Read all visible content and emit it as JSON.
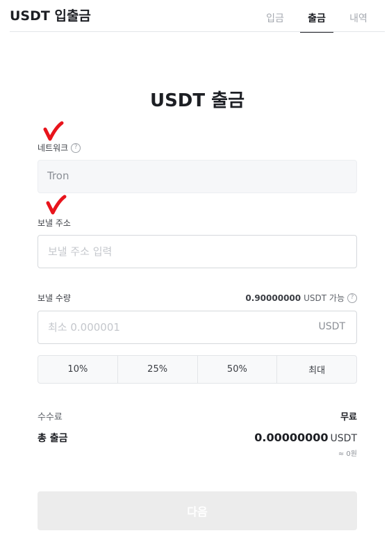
{
  "header": {
    "title": "USDT 입출금",
    "tabs": [
      {
        "label": "입금",
        "active": false
      },
      {
        "label": "출금",
        "active": true
      },
      {
        "label": "내역",
        "active": false
      }
    ]
  },
  "page_title": "USDT 출금",
  "network": {
    "label": "네트워크",
    "value": "Tron"
  },
  "address": {
    "label": "보낼 주소",
    "placeholder": "보낼 주소 입력"
  },
  "amount": {
    "label": "보낼 수량",
    "available_amount": "0.90000000",
    "available_suffix": "USDT 가능",
    "placeholder": "최소 0.000001",
    "unit": "USDT"
  },
  "percent_buttons": [
    "10%",
    "25%",
    "50%",
    "최대"
  ],
  "fee": {
    "label": "수수료",
    "value": "무료"
  },
  "total": {
    "label": "총 출금",
    "amount": "0.00000000",
    "currency": "USDT",
    "krw": "≈ 0원"
  },
  "next_button": "다음",
  "help_glyph": "?",
  "colors": {
    "check_mark": "#e8141c",
    "active_tab": "#1d1f24",
    "disabled_button": "#ececec"
  }
}
